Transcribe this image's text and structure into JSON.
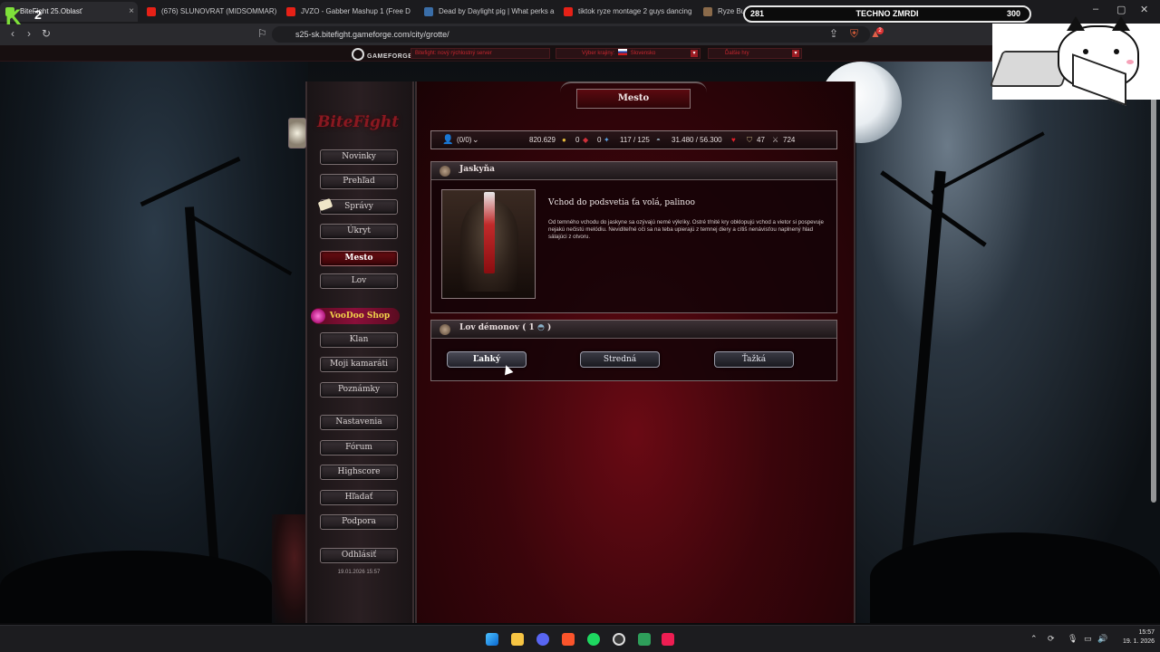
{
  "browser": {
    "tabs": [
      {
        "label": "BiteFight 25.Oblasť",
        "active": true
      },
      {
        "label": "(676) SLUNOVRAT (MIDSOMMAR) D",
        "active": false
      },
      {
        "label": "JVZO - Gabber Mashup 1 (Free D",
        "active": false
      },
      {
        "label": "Dead by Daylight pig | What perks a",
        "active": false
      },
      {
        "label": "tiktok ryze montage 2 guys dancing",
        "active": false
      },
      {
        "label": "Ryze Bu",
        "active": false
      }
    ],
    "url": "s25-sk.bitefight.gameforge.com/city/grotte/",
    "tab_close": "×",
    "ext_badge": "2"
  },
  "gameforge_bar": {
    "logo": "GAMEFORGE",
    "box1": "Bitefight: nový rýchlostný server",
    "box2_label": "Výber krajiny:",
    "box2_value": "Slovensko",
    "box3": "Ďalšie hry"
  },
  "game": {
    "logo": "BiteFight",
    "page_banner": "Mesto",
    "nav": [
      {
        "label": "Novinky",
        "active": false
      },
      {
        "label": "Prehľad",
        "active": false
      },
      {
        "label": "Správy",
        "active": false
      },
      {
        "label": "Úkryt",
        "active": false
      },
      {
        "label": "Mesto",
        "active": true
      },
      {
        "label": "Lov",
        "active": false
      }
    ],
    "voodoo_shop": "VooDoo Shop",
    "nav2": [
      {
        "label": "Klan"
      },
      {
        "label": "Moji kamaráti"
      },
      {
        "label": "Poznámky"
      },
      {
        "label": "Nastavenia"
      },
      {
        "label": "Fórum"
      },
      {
        "label": "Highscore"
      },
      {
        "label": "Hľadať"
      },
      {
        "label": "Podpora"
      },
      {
        "label": "Odhlásiť"
      }
    ],
    "server_datetime": "19.01.2026 15:57",
    "status": {
      "players": "(0/0)",
      "gold": "820.629",
      "hellstones": "0",
      "fragments": "0",
      "ap": "117 / 125",
      "hp": "31.480 / 56.300",
      "level": "47",
      "battle": "724"
    },
    "cave_panel": {
      "title": "Jaskyňa",
      "heading": "Vchod do podsvetia ťa volá, palinoo",
      "description": "Od temného vchodu do jaskyne sa ozývajú nemé výkriky. Ostré tŕnité kry obklopujú vchod a vietor si pospevuje nejakú nečistú melódiu. Neviditeľné oči sa na teba upierajú z temnej diery a cítiš nenávisťou naplnený hlad sálajúci z otvoru."
    },
    "demon_panel": {
      "title_prefix": "Lov démonov ( 1",
      "title_suffix": ")",
      "buttons": [
        "Ľahký",
        "Stredná",
        "Ťažká"
      ]
    }
  },
  "overlay": {
    "left_count": "281",
    "title": "TECHNO ZMRDI",
    "right_count": "300",
    "brand_letter": "K",
    "brand_num": "2"
  },
  "taskbar": {
    "time": "15:57",
    "date": "19. 1. 2026"
  },
  "colors": {
    "accent_red": "#6a0d12",
    "gold": "#f3d34a",
    "voodoo": "#8a0f3a",
    "overlay_green": "#7ee03a"
  }
}
